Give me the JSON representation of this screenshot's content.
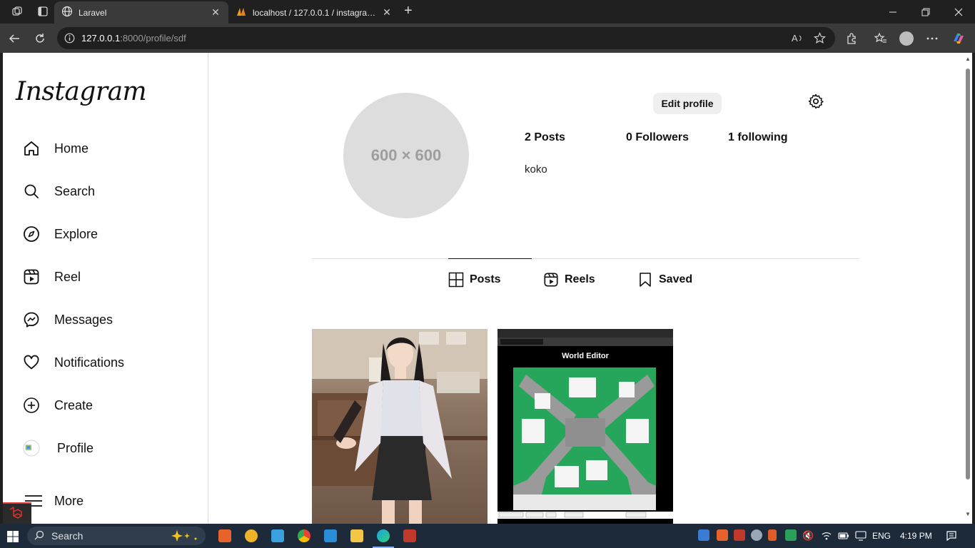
{
  "browser": {
    "tabs": [
      {
        "title": "Laravel"
      },
      {
        "title": "localhost / 127.0.0.1 / instagram_c"
      }
    ],
    "url_host": "127.0.0.1",
    "url_path": ":8000/profile/sdf"
  },
  "sidebar": {
    "logo": "Instagram",
    "items": [
      {
        "label": "Home",
        "icon": "home-icon"
      },
      {
        "label": "Search",
        "icon": "search-icon"
      },
      {
        "label": "Explore",
        "icon": "compass-icon"
      },
      {
        "label": "Reel",
        "icon": "reel-icon"
      },
      {
        "label": "Messages",
        "icon": "messenger-icon"
      },
      {
        "label": "Notifications",
        "icon": "heart-icon"
      },
      {
        "label": "Create",
        "icon": "plus-square-icon"
      },
      {
        "label": "Profile",
        "icon": "avatar"
      },
      {
        "label": "More",
        "icon": "hamburger-icon"
      }
    ]
  },
  "profile": {
    "placeholder": "600 × 600",
    "edit_label": "Edit profile",
    "posts": "2 Posts",
    "followers": "0 Followers",
    "following": "1 following",
    "bio": "koko"
  },
  "profile_tabs": [
    {
      "label": "Posts"
    },
    {
      "label": "Reels"
    },
    {
      "label": "Saved"
    }
  ],
  "posts": [
    {
      "kind": "photo"
    },
    {
      "kind": "screenshot",
      "caption": "World Editor"
    }
  ],
  "taskbar": {
    "search_label": "Search",
    "lang": "ENG",
    "time": "4:19 PM"
  }
}
